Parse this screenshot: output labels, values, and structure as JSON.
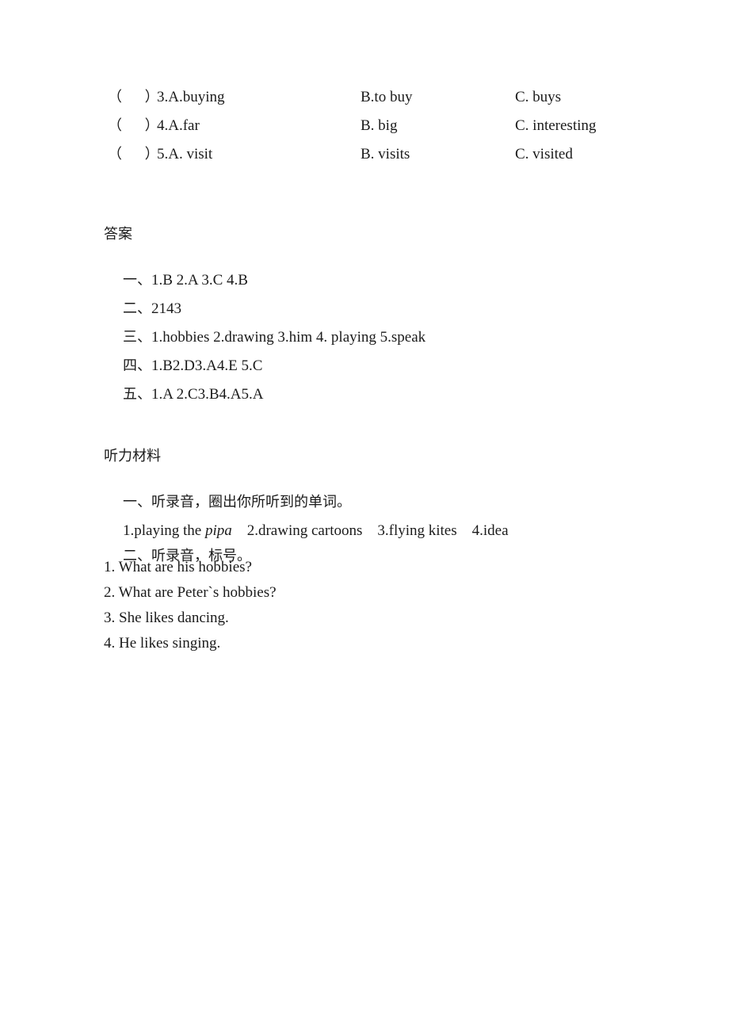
{
  "document": {
    "multiple_choice": {
      "rows": [
        {
          "bracket": "（     ）",
          "a": "3.A.buying",
          "b": "B.to buy",
          "c": "C. buys"
        },
        {
          "bracket": "（     ）",
          "a": "4.A.far",
          "b": "B. big",
          "c": "C. interesting"
        },
        {
          "bracket": "（     ）",
          "a": "5.A. visit",
          "b": "B. visits",
          "c": "C. visited"
        }
      ]
    },
    "answers": {
      "heading": "答案",
      "rows": [
        {
          "label": "一、",
          "body": "1.B 2.A 3.C 4.B"
        },
        {
          "label": "二、",
          "body": "2143"
        },
        {
          "label": "三、",
          "body": "1.hobbies 2.drawing 3.him 4. playing 5.speak"
        },
        {
          "label": "四、",
          "body": "1.B2.D3.A4.E 5.C"
        },
        {
          "label": "五、",
          "body": "1.A 2.C3.B4.A5.A"
        }
      ]
    },
    "listening_material": {
      "heading": "听力材料",
      "section_one": {
        "label": "一、",
        "instruction": "听录音，圈出你所听到的单词。",
        "items_prefix": "1.playing the ",
        "items_italic": "pipa",
        "items_suffix": "    2.drawing cartoons    3.flying kites    4.idea"
      },
      "section_two": {
        "label": "二、",
        "instruction": "听录音，标号。",
        "sentences": [
          "1. What are his hobbies?",
          "2. What are Peter`s hobbies?",
          "3. She likes dancing.",
          "4. He likes singing."
        ]
      }
    }
  }
}
